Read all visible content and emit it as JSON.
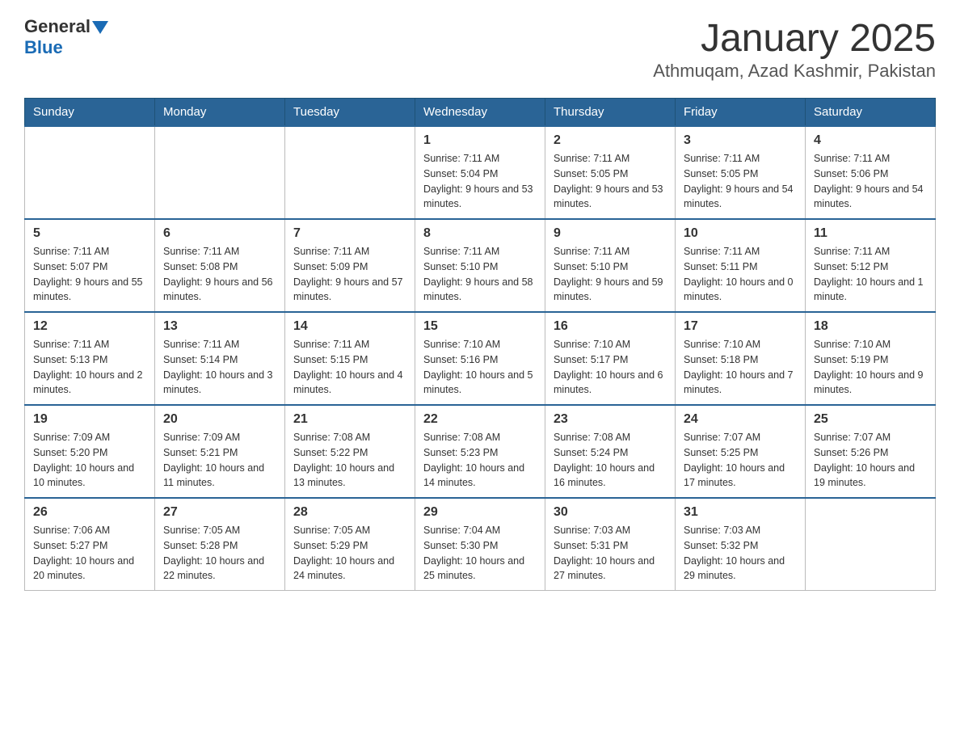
{
  "header": {
    "logo": {
      "part1": "General",
      "triangle": "▶",
      "part2": "Blue"
    },
    "title": "January 2025",
    "location": "Athmuqam, Azad Kashmir, Pakistan"
  },
  "days_of_week": [
    "Sunday",
    "Monday",
    "Tuesday",
    "Wednesday",
    "Thursday",
    "Friday",
    "Saturday"
  ],
  "weeks": [
    [
      {
        "day": "",
        "info": ""
      },
      {
        "day": "",
        "info": ""
      },
      {
        "day": "",
        "info": ""
      },
      {
        "day": "1",
        "info": "Sunrise: 7:11 AM\nSunset: 5:04 PM\nDaylight: 9 hours and 53 minutes."
      },
      {
        "day": "2",
        "info": "Sunrise: 7:11 AM\nSunset: 5:05 PM\nDaylight: 9 hours and 53 minutes."
      },
      {
        "day": "3",
        "info": "Sunrise: 7:11 AM\nSunset: 5:05 PM\nDaylight: 9 hours and 54 minutes."
      },
      {
        "day": "4",
        "info": "Sunrise: 7:11 AM\nSunset: 5:06 PM\nDaylight: 9 hours and 54 minutes."
      }
    ],
    [
      {
        "day": "5",
        "info": "Sunrise: 7:11 AM\nSunset: 5:07 PM\nDaylight: 9 hours and 55 minutes."
      },
      {
        "day": "6",
        "info": "Sunrise: 7:11 AM\nSunset: 5:08 PM\nDaylight: 9 hours and 56 minutes."
      },
      {
        "day": "7",
        "info": "Sunrise: 7:11 AM\nSunset: 5:09 PM\nDaylight: 9 hours and 57 minutes."
      },
      {
        "day": "8",
        "info": "Sunrise: 7:11 AM\nSunset: 5:10 PM\nDaylight: 9 hours and 58 minutes."
      },
      {
        "day": "9",
        "info": "Sunrise: 7:11 AM\nSunset: 5:10 PM\nDaylight: 9 hours and 59 minutes."
      },
      {
        "day": "10",
        "info": "Sunrise: 7:11 AM\nSunset: 5:11 PM\nDaylight: 10 hours and 0 minutes."
      },
      {
        "day": "11",
        "info": "Sunrise: 7:11 AM\nSunset: 5:12 PM\nDaylight: 10 hours and 1 minute."
      }
    ],
    [
      {
        "day": "12",
        "info": "Sunrise: 7:11 AM\nSunset: 5:13 PM\nDaylight: 10 hours and 2 minutes."
      },
      {
        "day": "13",
        "info": "Sunrise: 7:11 AM\nSunset: 5:14 PM\nDaylight: 10 hours and 3 minutes."
      },
      {
        "day": "14",
        "info": "Sunrise: 7:11 AM\nSunset: 5:15 PM\nDaylight: 10 hours and 4 minutes."
      },
      {
        "day": "15",
        "info": "Sunrise: 7:10 AM\nSunset: 5:16 PM\nDaylight: 10 hours and 5 minutes."
      },
      {
        "day": "16",
        "info": "Sunrise: 7:10 AM\nSunset: 5:17 PM\nDaylight: 10 hours and 6 minutes."
      },
      {
        "day": "17",
        "info": "Sunrise: 7:10 AM\nSunset: 5:18 PM\nDaylight: 10 hours and 7 minutes."
      },
      {
        "day": "18",
        "info": "Sunrise: 7:10 AM\nSunset: 5:19 PM\nDaylight: 10 hours and 9 minutes."
      }
    ],
    [
      {
        "day": "19",
        "info": "Sunrise: 7:09 AM\nSunset: 5:20 PM\nDaylight: 10 hours and 10 minutes."
      },
      {
        "day": "20",
        "info": "Sunrise: 7:09 AM\nSunset: 5:21 PM\nDaylight: 10 hours and 11 minutes."
      },
      {
        "day": "21",
        "info": "Sunrise: 7:08 AM\nSunset: 5:22 PM\nDaylight: 10 hours and 13 minutes."
      },
      {
        "day": "22",
        "info": "Sunrise: 7:08 AM\nSunset: 5:23 PM\nDaylight: 10 hours and 14 minutes."
      },
      {
        "day": "23",
        "info": "Sunrise: 7:08 AM\nSunset: 5:24 PM\nDaylight: 10 hours and 16 minutes."
      },
      {
        "day": "24",
        "info": "Sunrise: 7:07 AM\nSunset: 5:25 PM\nDaylight: 10 hours and 17 minutes."
      },
      {
        "day": "25",
        "info": "Sunrise: 7:07 AM\nSunset: 5:26 PM\nDaylight: 10 hours and 19 minutes."
      }
    ],
    [
      {
        "day": "26",
        "info": "Sunrise: 7:06 AM\nSunset: 5:27 PM\nDaylight: 10 hours and 20 minutes."
      },
      {
        "day": "27",
        "info": "Sunrise: 7:05 AM\nSunset: 5:28 PM\nDaylight: 10 hours and 22 minutes."
      },
      {
        "day": "28",
        "info": "Sunrise: 7:05 AM\nSunset: 5:29 PM\nDaylight: 10 hours and 24 minutes."
      },
      {
        "day": "29",
        "info": "Sunrise: 7:04 AM\nSunset: 5:30 PM\nDaylight: 10 hours and 25 minutes."
      },
      {
        "day": "30",
        "info": "Sunrise: 7:03 AM\nSunset: 5:31 PM\nDaylight: 10 hours and 27 minutes."
      },
      {
        "day": "31",
        "info": "Sunrise: 7:03 AM\nSunset: 5:32 PM\nDaylight: 10 hours and 29 minutes."
      },
      {
        "day": "",
        "info": ""
      }
    ]
  ]
}
